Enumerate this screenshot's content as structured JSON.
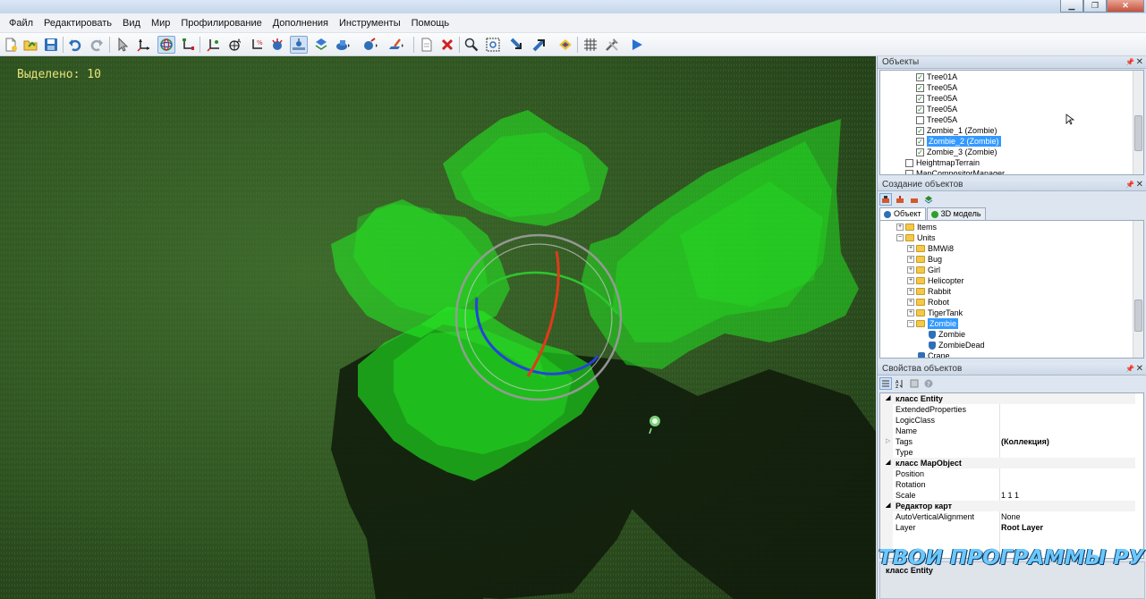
{
  "window": {
    "buttons": [
      "▁",
      "❐",
      "✕"
    ]
  },
  "menu": [
    "Файл",
    "Редактировать",
    "Вид",
    "Мир",
    "Профилирование",
    "Дополнения",
    "Инструменты",
    "Помощь"
  ],
  "toolbar_icons": [
    "new-file-icon",
    "open-file-icon",
    "save-icon",
    "undo-icon",
    "redo-icon",
    "select-arrow-icon",
    "move-axes-icon",
    "rotate-gizmo-icon",
    "scale-axes-icon",
    "snap-axes-icon",
    "grid-snap-icon",
    "axis-percent-icon",
    "paint-icon",
    "terrain-icon",
    "layer-icon",
    "object-icon",
    "brush-icon",
    "document-icon",
    "delete-icon",
    "search-icon",
    "zoom-frame-icon",
    "import-icon",
    "export-icon",
    "palette-icon",
    "grid-icon",
    "tools-icon",
    "play-icon"
  ],
  "viewport": {
    "selected_text": "Выделено: 10"
  },
  "objects_panel": {
    "title": "Объекты",
    "items": [
      {
        "label": "Tree01A",
        "checked": true
      },
      {
        "label": "Tree05A",
        "checked": true
      },
      {
        "label": "Tree05A",
        "checked": true
      },
      {
        "label": "Tree05A",
        "checked": true
      },
      {
        "label": "Tree05A",
        "checked": false
      },
      {
        "label": "Zombie_1 (Zombie)",
        "checked": true
      },
      {
        "label": "Zombie_2 (Zombie)",
        "checked": true,
        "selected": true
      },
      {
        "label": "Zombie_3 (Zombie)",
        "checked": true
      },
      {
        "label": "HeightmapTerrain",
        "checked": false
      },
      {
        "label": "MapCompositorManager",
        "checked": false
      }
    ]
  },
  "create_panel": {
    "title": "Создание объектов",
    "tabs": [
      "Объект",
      "3D модель"
    ],
    "tree": [
      {
        "label": "Items",
        "type": "folder",
        "depth": 0
      },
      {
        "label": "Units",
        "type": "folder",
        "depth": 0,
        "expanded": true
      },
      {
        "label": "BMWi8",
        "type": "folder",
        "depth": 1
      },
      {
        "label": "Bug",
        "type": "folder",
        "depth": 1
      },
      {
        "label": "Girl",
        "type": "folder",
        "depth": 1
      },
      {
        "label": "Helicopter",
        "type": "folder",
        "depth": 1
      },
      {
        "label": "Rabbit",
        "type": "folder",
        "depth": 1
      },
      {
        "label": "Robot",
        "type": "folder",
        "depth": 1
      },
      {
        "label": "TigerTank",
        "type": "folder",
        "depth": 1
      },
      {
        "label": "Zombie",
        "type": "folder",
        "depth": 1,
        "expanded": true,
        "selected": true
      },
      {
        "label": "Zombie",
        "type": "unit",
        "depth": 2
      },
      {
        "label": "ZombieDead",
        "type": "unit",
        "depth": 2
      },
      {
        "label": "Crane",
        "type": "unit",
        "depth": 0
      }
    ]
  },
  "props_panel": {
    "title": "Свойства объектов",
    "rows": [
      {
        "kind": "cat",
        "name": "класс Entity"
      },
      {
        "kind": "prop",
        "name": "ExtendedProperties",
        "value": ""
      },
      {
        "kind": "prop",
        "name": "LogicClass",
        "value": ""
      },
      {
        "kind": "prop",
        "name": "Name",
        "value": ""
      },
      {
        "kind": "prop",
        "name": "Tags",
        "value": "(Коллекция)",
        "bold": true,
        "expandable": true
      },
      {
        "kind": "prop",
        "name": "Type",
        "value": ""
      },
      {
        "kind": "cat",
        "name": "класс MapObject"
      },
      {
        "kind": "prop",
        "name": "Position",
        "value": ""
      },
      {
        "kind": "prop",
        "name": "Rotation",
        "value": ""
      },
      {
        "kind": "prop",
        "name": "Scale",
        "value": "1 1 1"
      },
      {
        "kind": "cat",
        "name": "Редактор карт"
      },
      {
        "kind": "prop",
        "name": "AutoVerticalAlignment",
        "value": "None"
      },
      {
        "kind": "prop",
        "name": "Layer",
        "value": "Root Layer",
        "bold": true
      }
    ],
    "description": "класс Entity"
  },
  "watermark": "ТВОИ ПРОГРАММЫ РУ",
  "colors": {
    "accent_selection": "#3399ff",
    "grass": "#2b4a1f",
    "tree_green": "#22ee22",
    "label_yellow": "#e9e37a"
  }
}
